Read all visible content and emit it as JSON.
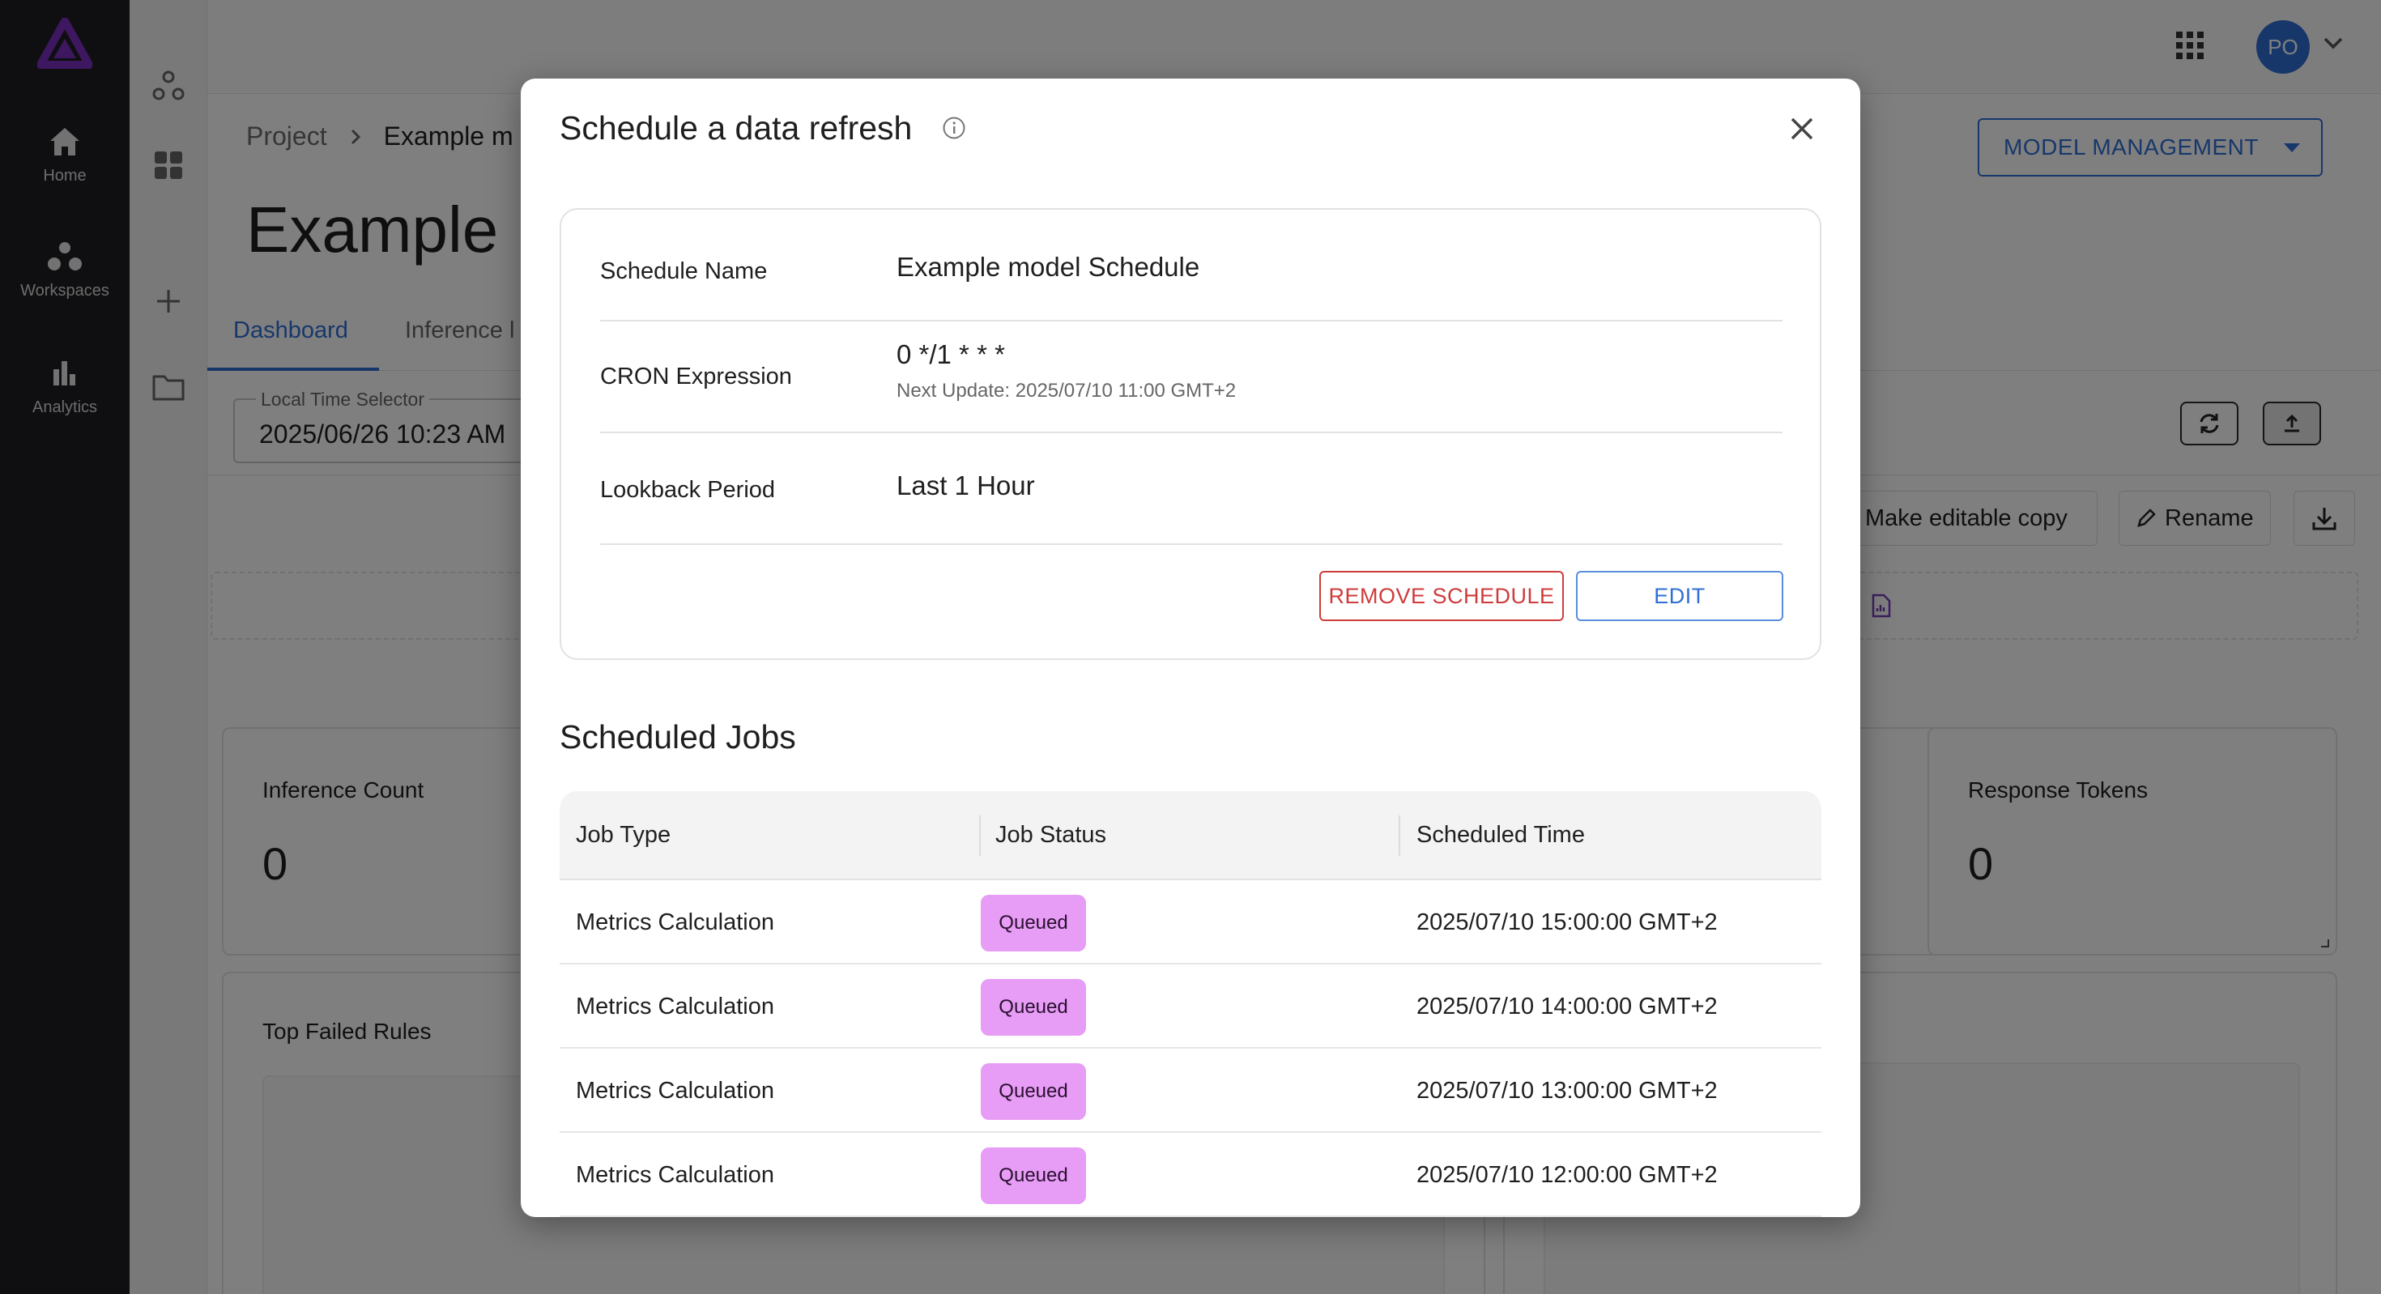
{
  "nav": {
    "items": [
      {
        "label": "Home",
        "icon": "home-icon"
      },
      {
        "label": "Workspaces",
        "icon": "workspaces-icon"
      },
      {
        "label": "Analytics",
        "icon": "bar-chart-icon"
      }
    ],
    "brand_color": "#7b2fbf"
  },
  "header": {
    "avatar_initials": "PO",
    "breadcrumb": {
      "root": "Project",
      "current": "Example m"
    },
    "page_title": "Example n",
    "model_management_label": "MODEL MANAGEMENT"
  },
  "tabs": [
    {
      "label": "Dashboard",
      "active": true
    },
    {
      "label": "Inference l",
      "active": false
    }
  ],
  "time_selector": {
    "label": "Local Time Selector",
    "value": "2025/06/26 10:23 AM"
  },
  "actions": {
    "edit_copy": "Make editable copy",
    "rename": "Rename"
  },
  "cards": [
    {
      "title": "Inference Count",
      "value": "0"
    },
    {
      "title": "Response Tokens",
      "value": "0"
    }
  ],
  "panels": {
    "top_failed_rules": "Top Failed Rules"
  },
  "modal": {
    "title": "Schedule a data refresh",
    "schedule": {
      "name_label": "Schedule Name",
      "name_value": "Example model Schedule",
      "cron_label": "CRON Expression",
      "cron_value": "0 */1 * * *",
      "next_update": "Next Update: 2025/07/10 11:00 GMT+2",
      "lookback_label": "Lookback Period",
      "lookback_value": "Last 1 Hour"
    },
    "remove_label": "REMOVE SCHEDULE",
    "edit_label": "EDIT",
    "jobs_title": "Scheduled Jobs",
    "jobs_columns": [
      "Job Type",
      "Job Status",
      "Scheduled Time"
    ],
    "jobs": [
      {
        "type": "Metrics Calculation",
        "status": "Queued",
        "time": "2025/07/10 15:00:00 GMT+2"
      },
      {
        "type": "Metrics Calculation",
        "status": "Queued",
        "time": "2025/07/10 14:00:00 GMT+2"
      },
      {
        "type": "Metrics Calculation",
        "status": "Queued",
        "time": "2025/07/10 13:00:00 GMT+2"
      },
      {
        "type": "Metrics Calculation",
        "status": "Queued",
        "time": "2025/07/10 12:00:00 GMT+2"
      }
    ],
    "status_color": "#e79cf5"
  }
}
